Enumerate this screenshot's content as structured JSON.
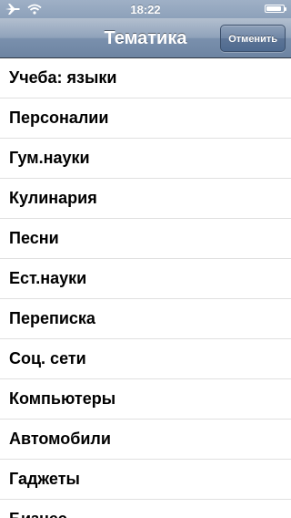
{
  "status_bar": {
    "time": "18:22",
    "battery_level": 0.9,
    "icons": [
      "airplane-icon",
      "wifi-icon",
      "battery-icon"
    ]
  },
  "nav_bar": {
    "title": "Тематика",
    "cancel_label": "Отменить"
  },
  "list": {
    "items": [
      {
        "label": "Учеба: языки"
      },
      {
        "label": "Персоналии"
      },
      {
        "label": "Гум.науки"
      },
      {
        "label": "Кулинария"
      },
      {
        "label": "Песни"
      },
      {
        "label": "Ест.науки"
      },
      {
        "label": "Переписка"
      },
      {
        "label": "Соц. сети"
      },
      {
        "label": "Компьютеры"
      },
      {
        "label": "Автомобили"
      },
      {
        "label": "Гаджеты"
      },
      {
        "label": "Бизнес"
      }
    ]
  },
  "colors": {
    "nav_bar": "#7a90ad",
    "separator": "#e0e0e0",
    "text": "#000000"
  }
}
